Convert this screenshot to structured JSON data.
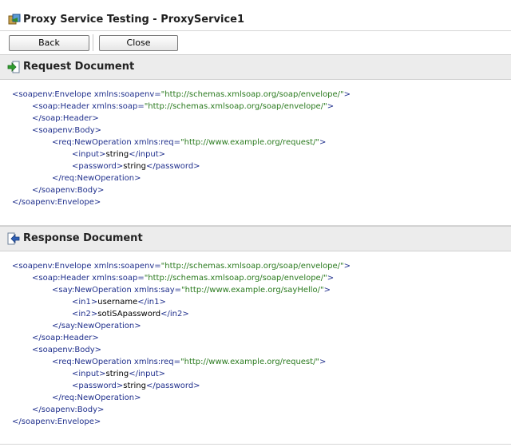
{
  "window": {
    "title": "Proxy Service Testing - ProxyService1"
  },
  "toolbar": {
    "back_label": "Back",
    "close_label": "Close"
  },
  "request": {
    "title": "Request Document",
    "lines": [
      {
        "indent": 0,
        "parts": [
          [
            "t",
            "<soapenv:Envelope "
          ],
          [
            "a",
            "xmlns:soapenv="
          ],
          [
            "v",
            "\"http://schemas.xmlsoap.org/soap/envelope/\""
          ],
          [
            "t",
            ">"
          ]
        ]
      },
      {
        "indent": 1,
        "parts": [
          [
            "t",
            "<soap:Header "
          ],
          [
            "a",
            "xmlns:soap="
          ],
          [
            "v",
            "\"http://schemas.xmlsoap.org/soap/envelope/\""
          ],
          [
            "t",
            ">"
          ]
        ]
      },
      {
        "indent": 1,
        "parts": [
          [
            "t",
            "</soap:Header>"
          ]
        ]
      },
      {
        "indent": 1,
        "parts": [
          [
            "t",
            "<soapenv:Body>"
          ]
        ]
      },
      {
        "indent": 2,
        "parts": [
          [
            "t",
            "<req:NewOperation "
          ],
          [
            "a",
            "xmlns:req="
          ],
          [
            "v",
            "\"http://www.example.org/request/\""
          ],
          [
            "t",
            ">"
          ]
        ]
      },
      {
        "indent": 3,
        "parts": [
          [
            "t",
            "<input>"
          ],
          [
            "x",
            "string"
          ],
          [
            "t",
            "</input>"
          ]
        ]
      },
      {
        "indent": 3,
        "parts": [
          [
            "t",
            "<password>"
          ],
          [
            "x",
            "string"
          ],
          [
            "t",
            "</password>"
          ]
        ]
      },
      {
        "indent": 2,
        "parts": [
          [
            "t",
            "</req:NewOperation>"
          ]
        ]
      },
      {
        "indent": 1,
        "parts": [
          [
            "t",
            "</soapenv:Body>"
          ]
        ]
      },
      {
        "indent": 0,
        "parts": [
          [
            "t",
            "</soapenv:Envelope>"
          ]
        ]
      }
    ]
  },
  "response": {
    "title": "Response Document",
    "lines": [
      {
        "indent": 0,
        "parts": [
          [
            "t",
            "<soapenv:Envelope "
          ],
          [
            "a",
            "xmlns:soapenv="
          ],
          [
            "v",
            "\"http://schemas.xmlsoap.org/soap/envelope/\""
          ],
          [
            "t",
            ">"
          ]
        ]
      },
      {
        "indent": 1,
        "parts": [
          [
            "t",
            "<soap:Header "
          ],
          [
            "a",
            "xmlns:soap="
          ],
          [
            "v",
            "\"http://schemas.xmlsoap.org/soap/envelope/\""
          ],
          [
            "t",
            ">"
          ]
        ]
      },
      {
        "indent": 2,
        "parts": [
          [
            "t",
            "<say:NewOperation "
          ],
          [
            "a",
            "xmlns:say="
          ],
          [
            "v",
            "\"http://www.example.org/sayHello/\""
          ],
          [
            "t",
            ">"
          ]
        ]
      },
      {
        "indent": 3,
        "parts": [
          [
            "t",
            "<in1>"
          ],
          [
            "x",
            "username"
          ],
          [
            "t",
            "</in1>"
          ]
        ]
      },
      {
        "indent": 3,
        "parts": [
          [
            "t",
            "<in2>"
          ],
          [
            "x",
            "sotiSApassword"
          ],
          [
            "t",
            "</in2>"
          ]
        ]
      },
      {
        "indent": 2,
        "parts": [
          [
            "t",
            "</say:NewOperation>"
          ]
        ]
      },
      {
        "indent": 1,
        "parts": [
          [
            "t",
            "</soap:Header>"
          ]
        ]
      },
      {
        "indent": 1,
        "parts": [
          [
            "t",
            "<soapenv:Body>"
          ]
        ]
      },
      {
        "indent": 2,
        "parts": [
          [
            "t",
            "<req:NewOperation "
          ],
          [
            "a",
            "xmlns:req="
          ],
          [
            "v",
            "\"http://www.example.org/request/\""
          ],
          [
            "t",
            ">"
          ]
        ]
      },
      {
        "indent": 3,
        "parts": [
          [
            "t",
            "<input>"
          ],
          [
            "x",
            "string"
          ],
          [
            "t",
            "</input>"
          ]
        ]
      },
      {
        "indent": 3,
        "parts": [
          [
            "t",
            "<password>"
          ],
          [
            "x",
            "string"
          ],
          [
            "t",
            "</password>"
          ]
        ]
      },
      {
        "indent": 2,
        "parts": [
          [
            "t",
            "</req:NewOperation>"
          ]
        ]
      },
      {
        "indent": 1,
        "parts": [
          [
            "t",
            "</soapenv:Body>"
          ]
        ]
      },
      {
        "indent": 0,
        "parts": [
          [
            "t",
            "</soapenv:Envelope>"
          ]
        ]
      }
    ]
  }
}
